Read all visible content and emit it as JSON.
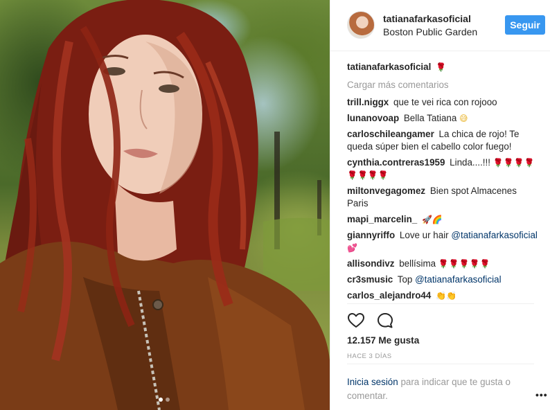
{
  "post": {
    "username": "tatianafarkasoficial",
    "location": "Boston Public Garden",
    "follow_label": "Seguir",
    "caption": "",
    "load_more_label": "Cargar más comentarios",
    "likes": "12.157 Me gusta",
    "time_ago": "HACE 3 DÍAS",
    "carousel": {
      "total": 2,
      "active_index": 0
    }
  },
  "comments": [
    {
      "user": "trill.niggx",
      "text": "que te vei rica con rojooo"
    },
    {
      "user": "lunanovoap",
      "text": "Bella Tatiana"
    },
    {
      "user": "carloschileangamer",
      "text": "La chica de rojo! Te queda súper bien el cabello color fuego!"
    },
    {
      "user": "cynthia.contreras1959",
      "text": "Linda....!!!"
    },
    {
      "user": "miltonvegagomez",
      "text": "Bien spot Almacenes Paris"
    },
    {
      "user": "mapi_marcelin_",
      "text": ""
    },
    {
      "user": "giannyriffo",
      "text": "Love ur hair",
      "mention": "@tatianafarkasoficial"
    },
    {
      "user": "allisondivz",
      "text": "bellísima"
    },
    {
      "user": "cr3smusic",
      "text": "Top",
      "mention": "@tatianafarkasoficial"
    },
    {
      "user": "carlos_alejandro44",
      "text": ""
    }
  ],
  "login_prompt": {
    "link": "Inicia sesión",
    "text": "para indicar que te gusta o comentar."
  },
  "icons": {
    "like": "heart-outline-icon",
    "comment": "speech-bubble-icon",
    "more": "ellipsis-icon",
    "emoji_rose": "rose-icon"
  },
  "colors": {
    "accent": "#3897f0",
    "text": "#262626",
    "muted": "#999999",
    "link": "#003569",
    "border": "#efefef"
  }
}
